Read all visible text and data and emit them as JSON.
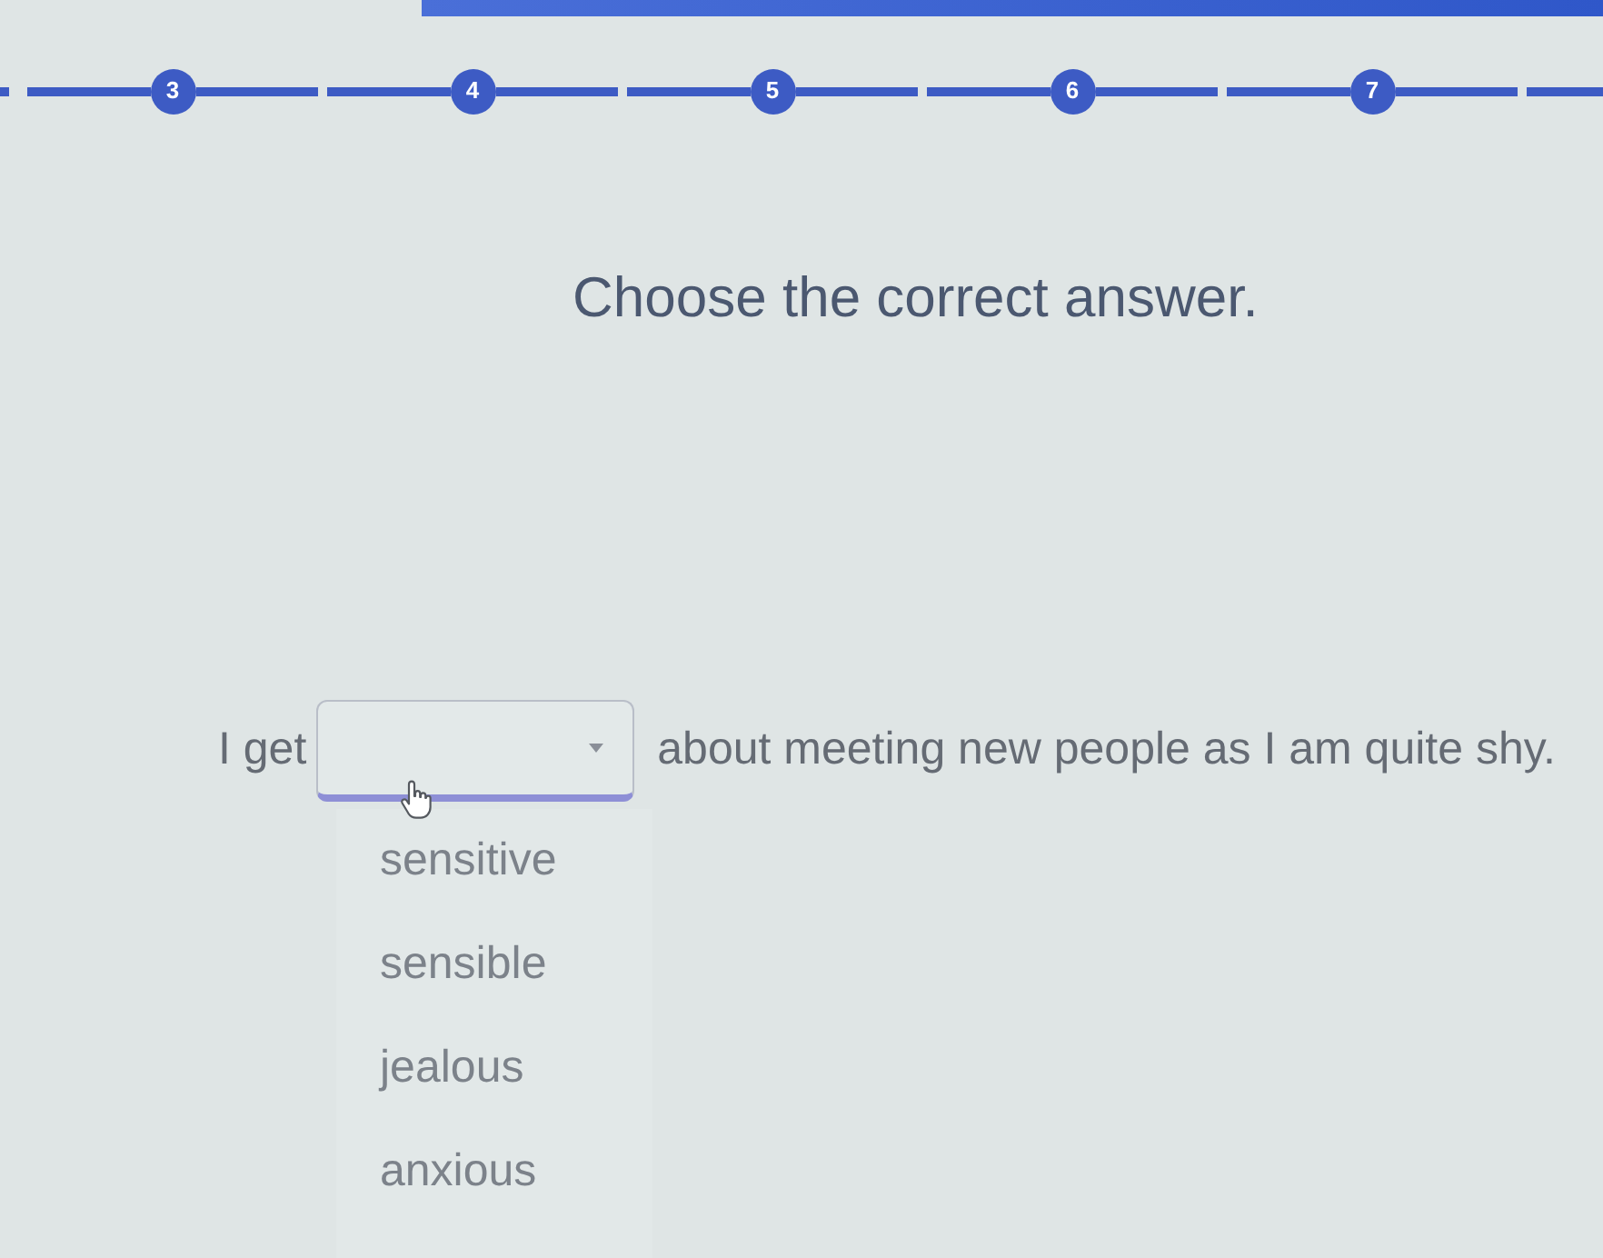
{
  "progress": {
    "steps": [
      {
        "label": "3"
      },
      {
        "label": "4"
      },
      {
        "label": "5"
      },
      {
        "label": "6"
      },
      {
        "label": "7"
      }
    ]
  },
  "question": {
    "title": "Choose the correct answer."
  },
  "sentence": {
    "before": "I get",
    "dropdown": {
      "expanded": true,
      "options": [
        {
          "label": "sensitive",
          "selected": false
        },
        {
          "label": "sensible",
          "selected": false
        },
        {
          "label": "jealous",
          "selected": false
        },
        {
          "label": "anxious",
          "selected": false
        }
      ]
    },
    "after": "about meeting new people as I am quite shy."
  }
}
